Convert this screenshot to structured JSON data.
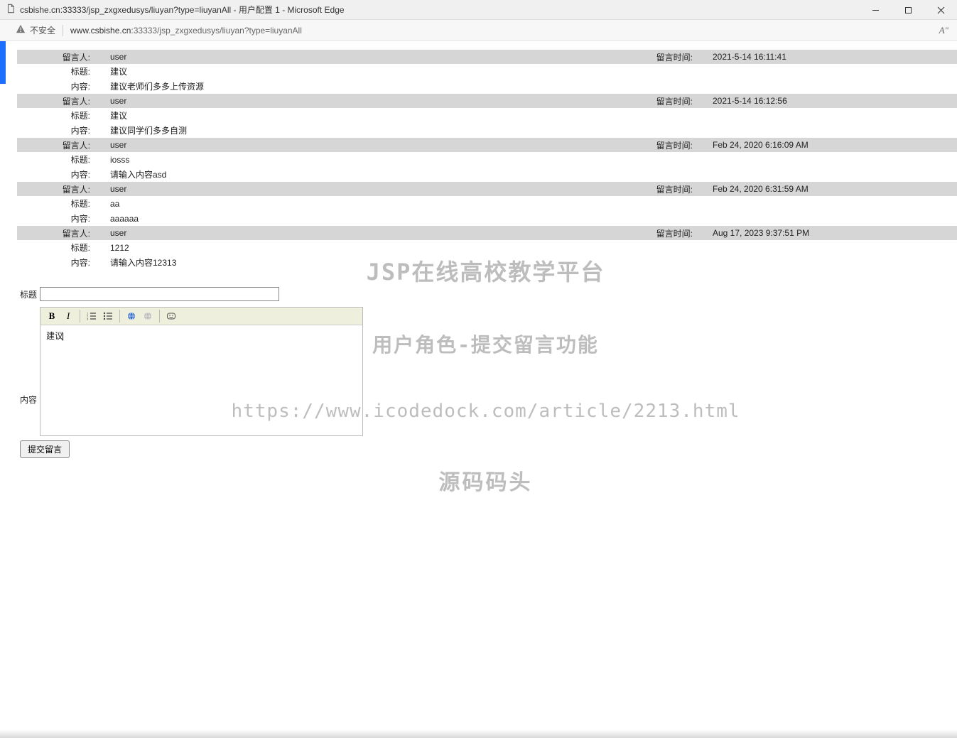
{
  "browser": {
    "tab_title": "csbishe.cn:33333/jsp_zxgxedusys/liuyan?type=liuyanAll - 用户配置 1 - Microsoft Edge",
    "insecure_label": "不安全",
    "url_host": "www.csbishe.cn",
    "url_rest": ":33333/jsp_zxgxedusys/liuyan?type=liuyanAll",
    "aa_label": "A\""
  },
  "labels": {
    "person": "留言人:",
    "time": "留言时间:",
    "title": "标题:",
    "content": "内容:"
  },
  "messages": [
    {
      "user": "user",
      "time": "2021-5-14 16:11:41",
      "title": "建议",
      "content": "建议老师们多多上传资源"
    },
    {
      "user": "user",
      "time": "2021-5-14 16:12:56",
      "title": "建议",
      "content": "建议同学们多多自测"
    },
    {
      "user": "user",
      "time": "Feb 24, 2020 6:16:09 AM",
      "title": "iosss",
      "content": "请输入内容asd"
    },
    {
      "user": "user",
      "time": "Feb 24, 2020 6:31:59 AM",
      "title": "aa",
      "content": "aaaaaa"
    },
    {
      "user": "user",
      "time": "Aug 17, 2023 9:37:51 PM",
      "title": "1212",
      "content": "请输入内容12313"
    }
  ],
  "form": {
    "title_label": "标题",
    "content_label": "内容",
    "title_value": "",
    "editor_text": "建议",
    "submit_label": "提交留言"
  },
  "watermark": {
    "line1": "JSP在线高校教学平台",
    "line2": "用户角色-提交留言功能",
    "line3": "https://www.icodedock.com/article/2213.html",
    "line4": "源码码头"
  }
}
